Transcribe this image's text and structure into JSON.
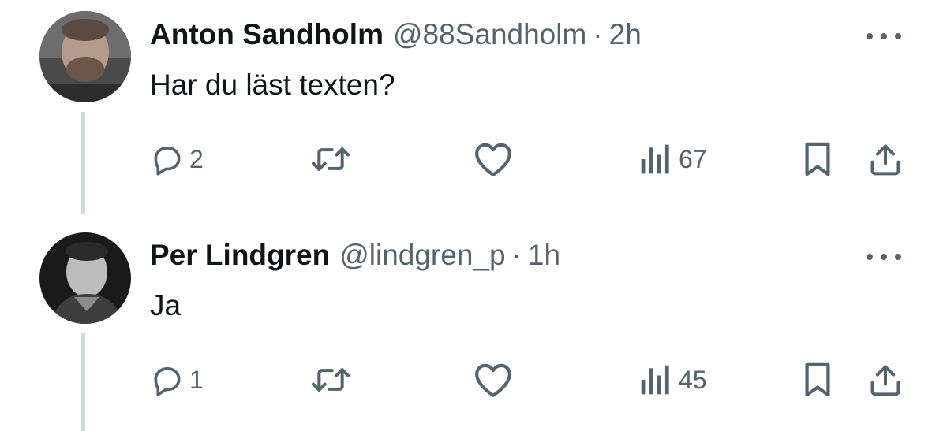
{
  "tweets": [
    {
      "name": "Anton Sandholm",
      "handle": "@88Sandholm",
      "separator": "·",
      "time": "2h",
      "text": "Har du läst texten?",
      "replies": "2",
      "views": "67",
      "avatar_icon": "avatar-photo-man-beard"
    },
    {
      "name": "Per Lindgren",
      "handle": "@lindgren_p",
      "separator": "·",
      "time": "1h",
      "text": "Ja",
      "replies": "1",
      "views": "45",
      "avatar_icon": "avatar-photo-man-bw"
    }
  ],
  "icons": {
    "reply": "reply-icon",
    "retweet": "retweet-icon",
    "like": "heart-icon",
    "views": "views-icon",
    "bookmark": "bookmark-icon",
    "share": "share-icon",
    "more": "more-icon"
  },
  "colors": {
    "text_primary": "#0f1419",
    "text_secondary": "#536471",
    "thread_line": "#cfd9de"
  }
}
